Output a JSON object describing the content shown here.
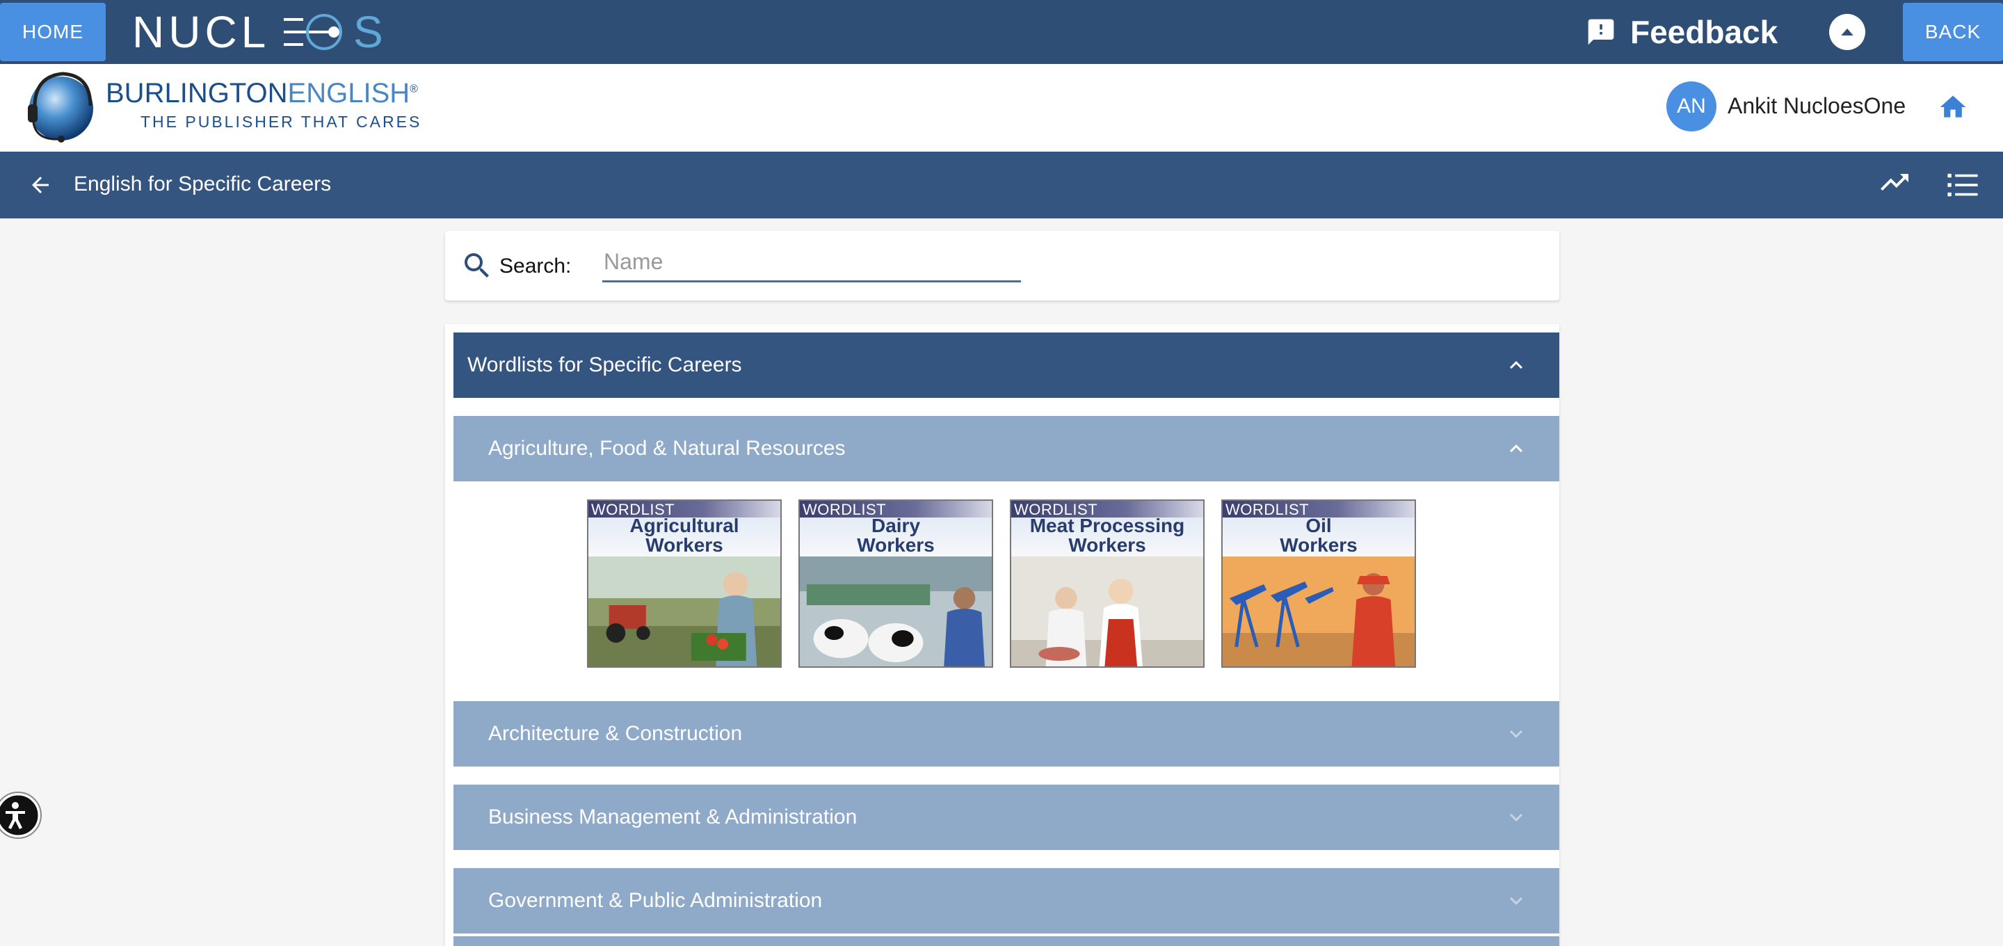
{
  "topbar": {
    "home_label": "HOME",
    "logo_text": "NUCLEOS",
    "feedback_label": "Feedback",
    "back_label": "BACK"
  },
  "brand": {
    "name_bold": "BURLINGTON",
    "name_light": "ENGLISH",
    "registered": "®",
    "tagline": "THE PUBLISHER THAT CARES"
  },
  "user": {
    "initials": "AN",
    "name": "Ankit NucloesOne"
  },
  "course": {
    "title": "English for Specific Careers"
  },
  "search": {
    "label": "Search:",
    "placeholder": "Name",
    "value": ""
  },
  "sections": {
    "main_title": "Wordlists for Specific Careers",
    "main_expanded": true,
    "categories": [
      {
        "label": "Agriculture, Food & Natural Resources",
        "expanded": true
      },
      {
        "label": "Architecture & Construction",
        "expanded": false
      },
      {
        "label": "Business Management & Administration",
        "expanded": false
      },
      {
        "label": "Government & Public Administration",
        "expanded": false
      }
    ]
  },
  "tiles": [
    {
      "tag": "WORDLIST",
      "title_line1": "Agricultural",
      "title_line2": "Workers"
    },
    {
      "tag": "WORDLIST",
      "title_line1": "Dairy",
      "title_line2": "Workers"
    },
    {
      "tag": "WORDLIST",
      "title_line1": "Meat Processing",
      "title_line2": "Workers"
    },
    {
      "tag": "WORDLIST",
      "title_line1": "Oil",
      "title_line2": "Workers"
    }
  ],
  "colors": {
    "topbar": "#2e4e76",
    "button": "#4a90e2",
    "course_bar": "#34557f",
    "category_bar": "#8fa9c8"
  }
}
